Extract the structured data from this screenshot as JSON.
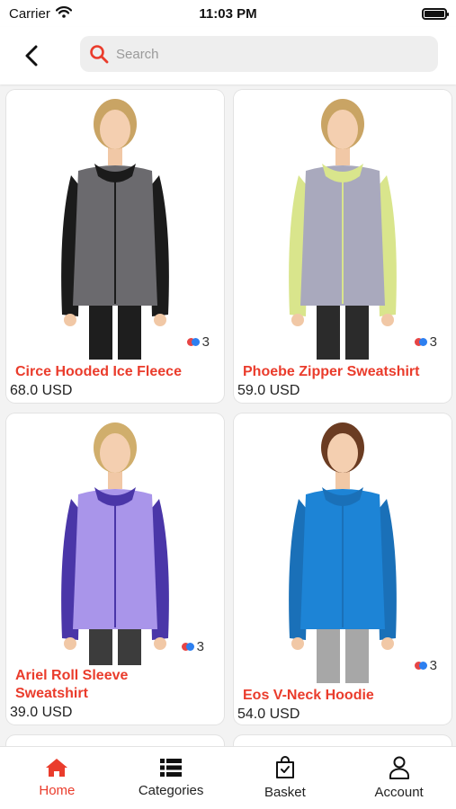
{
  "status_bar": {
    "carrier": "Carrier",
    "time": "11:03 PM"
  },
  "header": {
    "search_placeholder": "Search"
  },
  "products": [
    {
      "name": "Circe Hooded Ice Fleece",
      "price": "68.0 USD",
      "color_count": "3",
      "garment": "#6b6a6e",
      "trim": "#1b1b1b",
      "pants": "#1e1e1e",
      "hair": "#c9a464"
    },
    {
      "name": "Phoebe Zipper Sweatshirt",
      "price": "59.0 USD",
      "color_count": "3",
      "garment": "#a9a9bd",
      "trim": "#d9e58c",
      "pants": "#2b2b2b",
      "hair": "#c9a464"
    },
    {
      "name": "Ariel Roll Sleeve Sweatshirt",
      "price": "39.0 USD",
      "color_count": "3",
      "garment": "#a995ea",
      "trim": "#4a36a8",
      "pants": "#3c3c3c",
      "hair": "#d0ae6c"
    },
    {
      "name": "Eos V-Neck Hoodie",
      "price": "54.0 USD",
      "color_count": "3",
      "garment": "#1d84d6",
      "trim": "#1a70b8",
      "pants": "#a7a7a7",
      "hair": "#6b3c22"
    }
  ],
  "bottom_nav": [
    {
      "label": "Home",
      "icon": "home-icon",
      "active": true
    },
    {
      "label": "Categories",
      "icon": "categories-icon",
      "active": false
    },
    {
      "label": "Basket",
      "icon": "basket-icon",
      "active": false
    },
    {
      "label": "Account",
      "icon": "account-icon",
      "active": false
    }
  ],
  "colors": {
    "accent": "#ea3c2c",
    "dot_red": "#e74545",
    "dot_blue": "#2d7ff0"
  }
}
